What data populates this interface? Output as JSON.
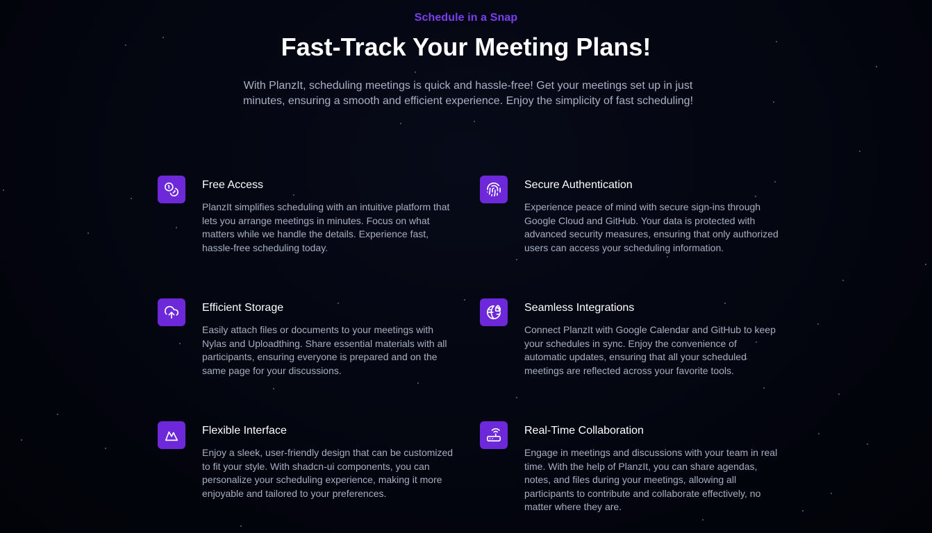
{
  "header": {
    "eyebrow": "Schedule in a Snap",
    "title": "Fast-Track Your Meeting Plans!",
    "subtitle": "With PlanzIt, scheduling meetings is quick and hassle-free! Get your meetings set up in just minutes, ensuring a smooth and efficient experience. Enjoy the simplicity of fast scheduling!"
  },
  "colors": {
    "background": "#03050f",
    "accent": "#7a3ff0",
    "icon_bg": "#6d28d9",
    "text_primary": "#ffffff",
    "text_secondary": "#a7afc2"
  },
  "features": [
    {
      "icon": "coins-icon",
      "title": "Free Access",
      "description": "PlanzIt simplifies scheduling with an intuitive platform that lets you arrange meetings in minutes. Focus on what matters while we handle the details. Experience fast, hassle-free scheduling today."
    },
    {
      "icon": "fingerprint-icon",
      "title": "Secure Authentication",
      "description": "Experience peace of mind with secure sign-ins through Google Cloud and GitHub. Your data is protected with advanced security measures, ensuring that only authorized users can access your scheduling information."
    },
    {
      "icon": "cloud-upload-icon",
      "title": "Efficient Storage",
      "description": "Easily attach files or documents to your meetings with Nylas and Uploadthing. Share essential materials with all participants, ensuring everyone is prepared and on the same page for your discussions."
    },
    {
      "icon": "globe-lock-icon",
      "title": "Seamless Integrations",
      "description": "Connect PlanzIt with Google Calendar and GitHub to keep your schedules in sync. Enjoy the convenience of automatic updates, ensuring that all your scheduled meetings are reflected across your favorite tools."
    },
    {
      "icon": "mountain-icon",
      "title": "Flexible Interface",
      "description": "Enjoy a sleek, user-friendly design that can be customized to fit your style. With shadcn-ui components, you can personalize your scheduling experience, making it more enjoyable and tailored to your preferences."
    },
    {
      "icon": "router-icon",
      "title": "Real-Time Collaboration",
      "description": "Engage in meetings and discussions with your team in real time. With the help of PlanzIt, you can share agendas, notes, and files during your meetings, allowing all participants to contribute and collaborate effectively, no matter where they are."
    }
  ]
}
